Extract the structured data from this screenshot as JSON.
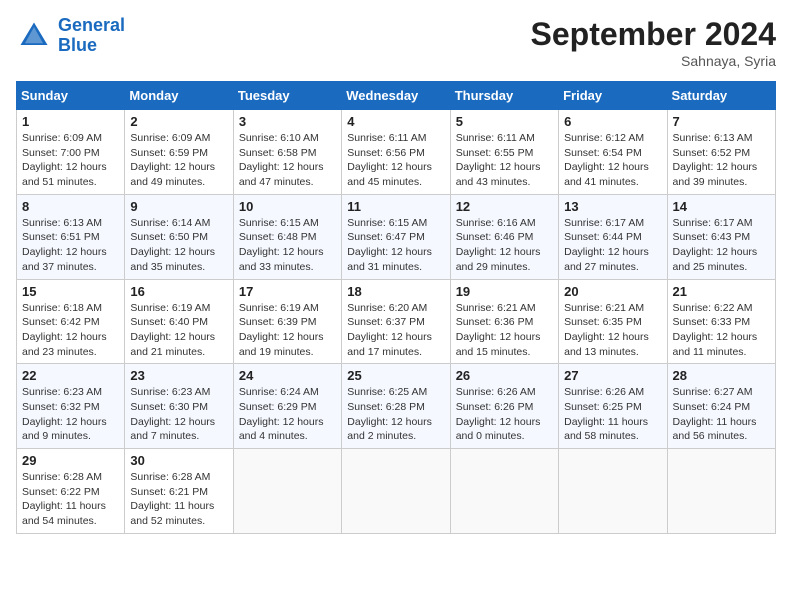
{
  "header": {
    "logo_line1": "General",
    "logo_line2": "Blue",
    "month_title": "September 2024",
    "location": "Sahnaya, Syria"
  },
  "days_of_week": [
    "Sunday",
    "Monday",
    "Tuesday",
    "Wednesday",
    "Thursday",
    "Friday",
    "Saturday"
  ],
  "weeks": [
    [
      {
        "day": "1",
        "info": "Sunrise: 6:09 AM\nSunset: 7:00 PM\nDaylight: 12 hours\nand 51 minutes."
      },
      {
        "day": "2",
        "info": "Sunrise: 6:09 AM\nSunset: 6:59 PM\nDaylight: 12 hours\nand 49 minutes."
      },
      {
        "day": "3",
        "info": "Sunrise: 6:10 AM\nSunset: 6:58 PM\nDaylight: 12 hours\nand 47 minutes."
      },
      {
        "day": "4",
        "info": "Sunrise: 6:11 AM\nSunset: 6:56 PM\nDaylight: 12 hours\nand 45 minutes."
      },
      {
        "day": "5",
        "info": "Sunrise: 6:11 AM\nSunset: 6:55 PM\nDaylight: 12 hours\nand 43 minutes."
      },
      {
        "day": "6",
        "info": "Sunrise: 6:12 AM\nSunset: 6:54 PM\nDaylight: 12 hours\nand 41 minutes."
      },
      {
        "day": "7",
        "info": "Sunrise: 6:13 AM\nSunset: 6:52 PM\nDaylight: 12 hours\nand 39 minutes."
      }
    ],
    [
      {
        "day": "8",
        "info": "Sunrise: 6:13 AM\nSunset: 6:51 PM\nDaylight: 12 hours\nand 37 minutes."
      },
      {
        "day": "9",
        "info": "Sunrise: 6:14 AM\nSunset: 6:50 PM\nDaylight: 12 hours\nand 35 minutes."
      },
      {
        "day": "10",
        "info": "Sunrise: 6:15 AM\nSunset: 6:48 PM\nDaylight: 12 hours\nand 33 minutes."
      },
      {
        "day": "11",
        "info": "Sunrise: 6:15 AM\nSunset: 6:47 PM\nDaylight: 12 hours\nand 31 minutes."
      },
      {
        "day": "12",
        "info": "Sunrise: 6:16 AM\nSunset: 6:46 PM\nDaylight: 12 hours\nand 29 minutes."
      },
      {
        "day": "13",
        "info": "Sunrise: 6:17 AM\nSunset: 6:44 PM\nDaylight: 12 hours\nand 27 minutes."
      },
      {
        "day": "14",
        "info": "Sunrise: 6:17 AM\nSunset: 6:43 PM\nDaylight: 12 hours\nand 25 minutes."
      }
    ],
    [
      {
        "day": "15",
        "info": "Sunrise: 6:18 AM\nSunset: 6:42 PM\nDaylight: 12 hours\nand 23 minutes."
      },
      {
        "day": "16",
        "info": "Sunrise: 6:19 AM\nSunset: 6:40 PM\nDaylight: 12 hours\nand 21 minutes."
      },
      {
        "day": "17",
        "info": "Sunrise: 6:19 AM\nSunset: 6:39 PM\nDaylight: 12 hours\nand 19 minutes."
      },
      {
        "day": "18",
        "info": "Sunrise: 6:20 AM\nSunset: 6:37 PM\nDaylight: 12 hours\nand 17 minutes."
      },
      {
        "day": "19",
        "info": "Sunrise: 6:21 AM\nSunset: 6:36 PM\nDaylight: 12 hours\nand 15 minutes."
      },
      {
        "day": "20",
        "info": "Sunrise: 6:21 AM\nSunset: 6:35 PM\nDaylight: 12 hours\nand 13 minutes."
      },
      {
        "day": "21",
        "info": "Sunrise: 6:22 AM\nSunset: 6:33 PM\nDaylight: 12 hours\nand 11 minutes."
      }
    ],
    [
      {
        "day": "22",
        "info": "Sunrise: 6:23 AM\nSunset: 6:32 PM\nDaylight: 12 hours\nand 9 minutes."
      },
      {
        "day": "23",
        "info": "Sunrise: 6:23 AM\nSunset: 6:30 PM\nDaylight: 12 hours\nand 7 minutes."
      },
      {
        "day": "24",
        "info": "Sunrise: 6:24 AM\nSunset: 6:29 PM\nDaylight: 12 hours\nand 4 minutes."
      },
      {
        "day": "25",
        "info": "Sunrise: 6:25 AM\nSunset: 6:28 PM\nDaylight: 12 hours\nand 2 minutes."
      },
      {
        "day": "26",
        "info": "Sunrise: 6:26 AM\nSunset: 6:26 PM\nDaylight: 12 hours\nand 0 minutes."
      },
      {
        "day": "27",
        "info": "Sunrise: 6:26 AM\nSunset: 6:25 PM\nDaylight: 11 hours\nand 58 minutes."
      },
      {
        "day": "28",
        "info": "Sunrise: 6:27 AM\nSunset: 6:24 PM\nDaylight: 11 hours\nand 56 minutes."
      }
    ],
    [
      {
        "day": "29",
        "info": "Sunrise: 6:28 AM\nSunset: 6:22 PM\nDaylight: 11 hours\nand 54 minutes."
      },
      {
        "day": "30",
        "info": "Sunrise: 6:28 AM\nSunset: 6:21 PM\nDaylight: 11 hours\nand 52 minutes."
      },
      {
        "day": "",
        "info": ""
      },
      {
        "day": "",
        "info": ""
      },
      {
        "day": "",
        "info": ""
      },
      {
        "day": "",
        "info": ""
      },
      {
        "day": "",
        "info": ""
      }
    ]
  ]
}
